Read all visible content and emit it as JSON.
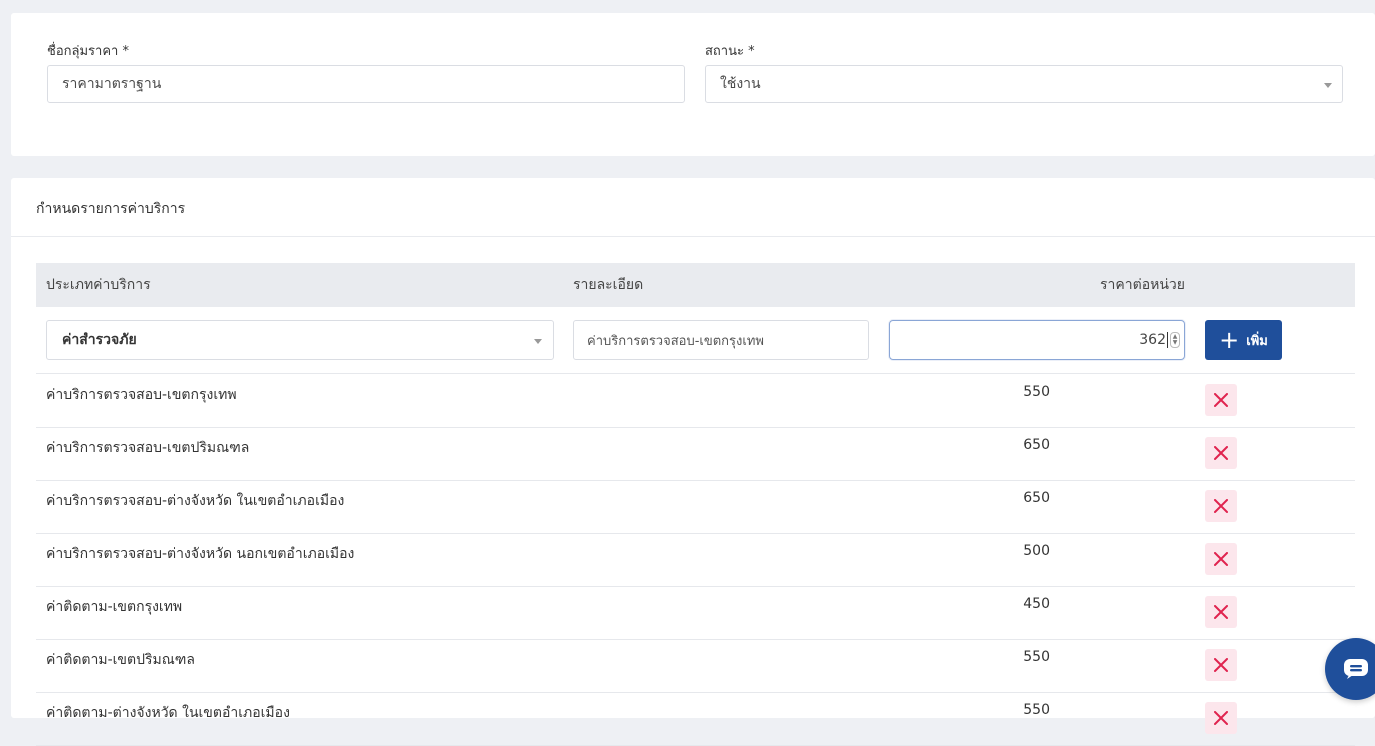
{
  "group": {
    "name_label": "ชื่อกลุ่มราคา *",
    "name_value": "ราคามาตราฐาน",
    "status_label": "สถานะ *",
    "status_value": "ใช้งาน"
  },
  "services": {
    "section_title": "กำหนดรายการค่าบริการ",
    "headers": {
      "type": "ประเภทค่าบริการ",
      "detail": "รายละเอียด",
      "unit_price": "ราคาต่อหน่วย"
    },
    "entry": {
      "type_value": "ค่าสำรวจภัย",
      "detail_value": "ค่าบริการตรวจสอบ-เขตกรุงเทพ",
      "price_value": "362",
      "add_label": "เพิ่ม"
    },
    "items": [
      {
        "name": "ค่าบริการตรวจสอบ-เขตกรุงเทพ",
        "price": "550"
      },
      {
        "name": "ค่าบริการตรวจสอบ-เขตปริมณฑล",
        "price": "650"
      },
      {
        "name": "ค่าบริการตรวจสอบ-ต่างจังหวัด ในเขตอำเภอเมือง",
        "price": "650"
      },
      {
        "name": "ค่าบริการตรวจสอบ-ต่างจังหวัด นอกเขตอำเภอเมือง",
        "price": "500"
      },
      {
        "name": "ค่าติดตาม-เขตกรุงเทพ",
        "price": "450"
      },
      {
        "name": "ค่าติดตาม-เขตปริมณฑล",
        "price": "550"
      },
      {
        "name": "ค่าติดตาม-ต่างจังหวัด ในเขตอำเภอเมือง",
        "price": "550"
      }
    ]
  },
  "icons": {
    "delete": "close-icon",
    "add": "plus-icon",
    "chat": "chat-icon"
  },
  "colors": {
    "primary": "#1f4f9b",
    "delete_bg": "#fce6ec",
    "delete_icon": "#e0244f"
  }
}
